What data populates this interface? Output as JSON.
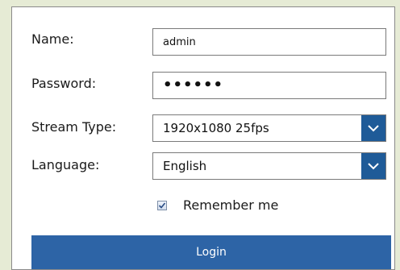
{
  "form": {
    "name_label": "Name:",
    "name_value": "admin",
    "password_label": "Password:",
    "password_value": "••••••",
    "stream_type_label": "Stream Type:",
    "stream_type_value": "1920x1080 25fps",
    "language_label": "Language:",
    "language_value": "English",
    "remember_label": "Remember me",
    "remember_checked": true,
    "login_label": "Login"
  },
  "colors": {
    "background": "#e6ebd5",
    "dropdown_arrow_bg": "#1f5b98",
    "login_button": "#2d64a6"
  },
  "icons": {
    "dropdown": "chevron-down-icon",
    "checkbox": "checkmark-icon"
  }
}
